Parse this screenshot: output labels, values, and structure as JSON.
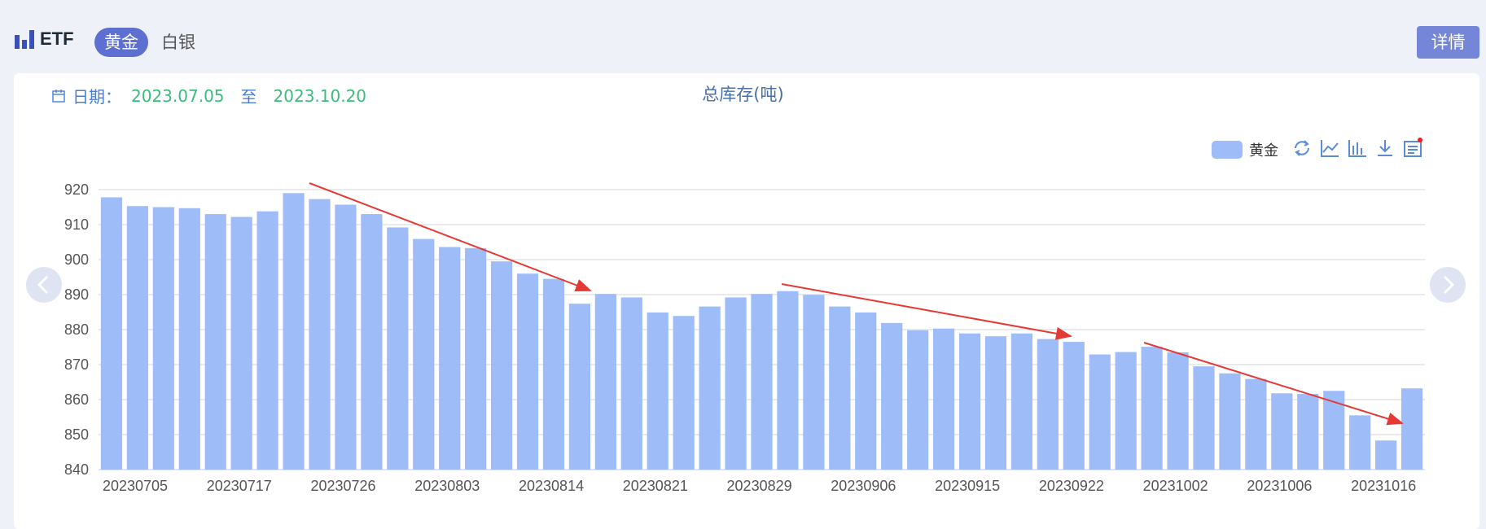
{
  "header": {
    "logo_text": "ETF",
    "tabs": [
      {
        "label": "黄金",
        "active": true
      },
      {
        "label": "白银",
        "active": false
      }
    ],
    "detail_button": "详情"
  },
  "filter": {
    "date_label": "日期：",
    "start_date": "2023.07.05",
    "separator": "至",
    "end_date": "2023.10.20"
  },
  "colors": {
    "bar": "#9dbcf8",
    "accent": "#5d6fd1",
    "annotation_arrow": "#e53935"
  },
  "toolbox": [
    "refresh-icon",
    "line-chart-icon",
    "bar-chart-icon",
    "download-icon",
    "data-view-icon"
  ],
  "chart_data": {
    "type": "bar",
    "title": "总库存(吨)",
    "xlabel": "",
    "ylabel": "",
    "ylim": [
      840,
      920
    ],
    "yticks": [
      840,
      850,
      860,
      870,
      880,
      890,
      900,
      910,
      920
    ],
    "legend": {
      "position": "top-right"
    },
    "grid": true,
    "x_tick_labels": [
      "20230705",
      "20230717",
      "20230726",
      "20230803",
      "20230814",
      "20230821",
      "20230829",
      "20230906",
      "20230915",
      "20230922",
      "20231002",
      "20231006",
      "20231016"
    ],
    "series": [
      {
        "name": "黄金",
        "values": [
          917.8,
          915.3,
          915.0,
          914.7,
          913.0,
          912.2,
          913.8,
          919.0,
          917.3,
          915.7,
          913.0,
          909.2,
          905.9,
          903.6,
          903.3,
          899.5,
          896.0,
          894.5,
          887.4,
          890.2,
          889.2,
          884.9,
          883.9,
          886.6,
          889.2,
          890.2,
          891.0,
          889.9,
          886.6,
          884.9,
          881.9,
          879.8,
          880.3,
          878.9,
          878.1,
          878.9,
          877.3,
          876.5,
          872.9,
          873.6,
          875.1,
          873.5,
          869.5,
          867.5,
          865.9,
          861.8,
          861.6,
          862.5,
          855.5,
          848.3,
          863.2
        ]
      }
    ],
    "annotations": [
      {
        "type": "arrow",
        "description": "downtrend"
      },
      {
        "type": "arrow",
        "description": "downtrend"
      },
      {
        "type": "arrow",
        "description": "downtrend"
      }
    ]
  }
}
